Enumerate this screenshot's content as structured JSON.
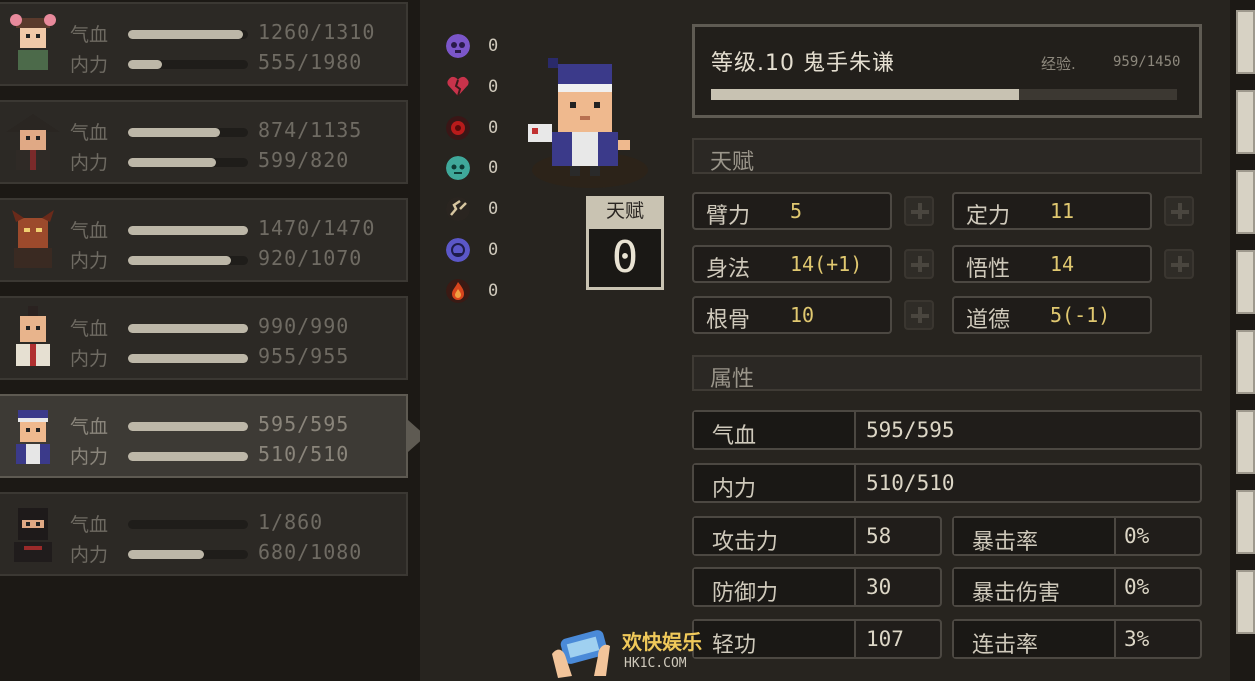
{
  "party": {
    "labels": {
      "hp": "气血",
      "mp": "内力"
    },
    "members": [
      {
        "hp": "1260/1310",
        "mp": "555/1980",
        "hp_frac": 0.96,
        "mp_frac": 0.28,
        "portrait": "girl-portrait-icon",
        "selected": false
      },
      {
        "hp": "874/1135",
        "mp": "599/820",
        "hp_frac": 0.77,
        "mp_frac": 0.73,
        "portrait": "straw-hat-portrait-icon",
        "selected": false
      },
      {
        "hp": "1470/1470",
        "mp": "920/1070",
        "hp_frac": 1.0,
        "mp_frac": 0.86,
        "portrait": "demon-portrait-icon",
        "selected": false
      },
      {
        "hp": "990/990",
        "mp": "955/955",
        "hp_frac": 1.0,
        "mp_frac": 1.0,
        "portrait": "warrior-portrait-icon",
        "selected": false
      },
      {
        "hp": "595/595",
        "mp": "510/510",
        "hp_frac": 1.0,
        "mp_frac": 1.0,
        "portrait": "headband-portrait-icon",
        "selected": true
      },
      {
        "hp": "1/860",
        "mp": "680/1080",
        "hp_frac": 0.0,
        "mp_frac": 0.63,
        "portrait": "ninja-portrait-icon",
        "selected": false
      }
    ]
  },
  "status_effects": [
    {
      "icon": "skull-icon",
      "count": "0",
      "color": "#7b56c9"
    },
    {
      "icon": "broken-heart-icon",
      "count": "0",
      "color": "#c8334b"
    },
    {
      "icon": "poison-icon",
      "count": "0",
      "color": "#b81b1b"
    },
    {
      "icon": "freeze-icon",
      "count": "0",
      "color": "#3fa89a"
    },
    {
      "icon": "dizzy-icon",
      "count": "0",
      "color": "#d7c6a0"
    },
    {
      "icon": "confuse-icon",
      "count": "0",
      "color": "#5b57c8"
    },
    {
      "icon": "fire-icon",
      "count": "0",
      "color": "#d8451d"
    }
  ],
  "talent_badge": {
    "title": "天赋",
    "value": "0"
  },
  "header": {
    "name": "等级.10 鬼手朱谦",
    "exp_label": "经验.",
    "exp_value": "959/1450",
    "exp_frac": 0.66
  },
  "sections": {
    "talent": "天赋",
    "attributes": "属性"
  },
  "talents": [
    {
      "name": "臂力",
      "value": "5"
    },
    {
      "name": "定力",
      "value": "11"
    },
    {
      "name": "身法",
      "value": "14(+1)"
    },
    {
      "name": "悟性",
      "value": "14"
    },
    {
      "name": "根骨",
      "value": "10"
    },
    {
      "name": "道德",
      "value": "5(-1)"
    }
  ],
  "stats": {
    "hp": {
      "name": "气血",
      "value": "595/595"
    },
    "mp": {
      "name": "内力",
      "value": "510/510"
    },
    "atk": {
      "name": "攻击力",
      "value": "58"
    },
    "crit": {
      "name": "暴击率",
      "value": "0%"
    },
    "def": {
      "name": "防御力",
      "value": "30"
    },
    "critdmg": {
      "name": "暴击伤害",
      "value": "0%"
    },
    "qinggong": {
      "name": "轻功",
      "value": "107"
    },
    "combo": {
      "name": "连击率",
      "value": "3%"
    }
  },
  "watermark": {
    "title": "欢快娱乐",
    "url": "HK1C.COM"
  }
}
